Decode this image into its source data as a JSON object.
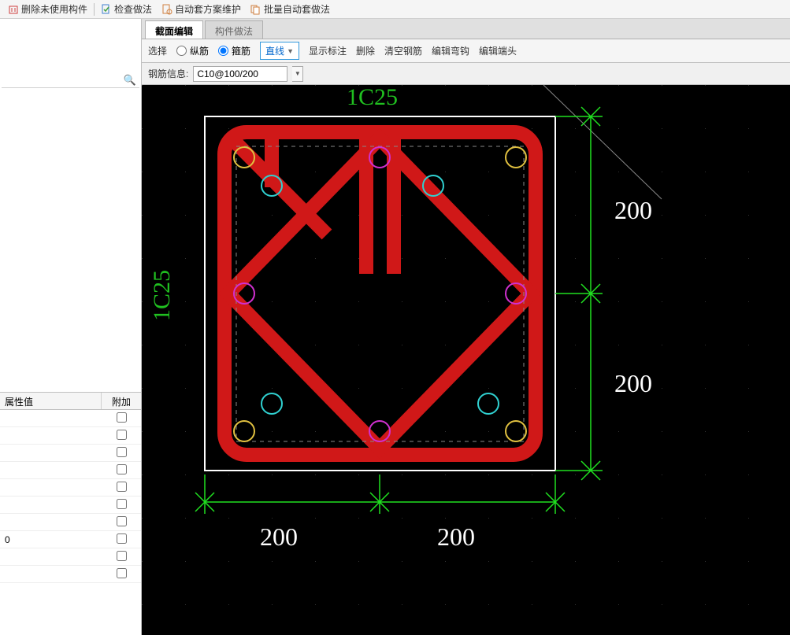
{
  "top_toolbar": {
    "delete_unused": "删除未使用构件",
    "check_method": "检查做法",
    "auto_scheme": "自动套方案维护",
    "batch_auto": "批量自动套做法"
  },
  "tabs": {
    "section_edit": "截面编辑",
    "component_method": "构件做法"
  },
  "edit_toolbar": {
    "select": "选择",
    "longitudinal": "纵筋",
    "stirrup": "箍筋",
    "line": "直线",
    "show_mark": "显示标注",
    "delete": "删除",
    "clear_rebar": "清空钢筋",
    "edit_hook": "编辑弯钩",
    "edit_end": "编辑端头"
  },
  "rebar": {
    "label": "钢筋信息:",
    "value": "C10@100/200"
  },
  "props": {
    "col_value": "属性值",
    "col_extra": "附加",
    "rows": [
      "",
      "",
      "",
      "",
      "",
      "",
      "",
      "0",
      "",
      ""
    ]
  },
  "canvas": {
    "label_top": "1C25",
    "label_left": "1C25",
    "dim_200": "200"
  }
}
